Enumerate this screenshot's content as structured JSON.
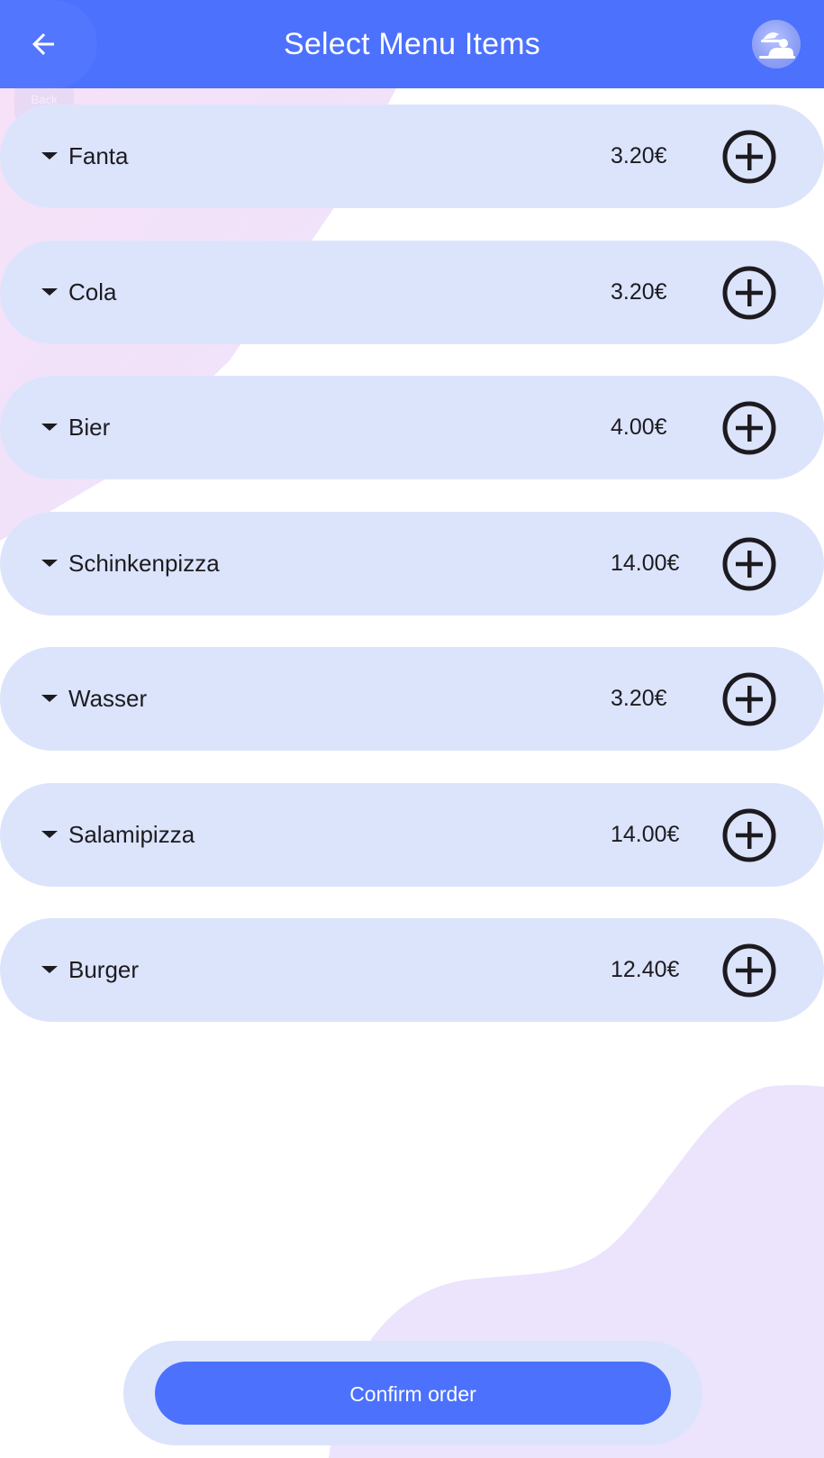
{
  "header": {
    "title": "Select Menu Items",
    "back_tooltip": "Back",
    "back_icon": "arrow-left-icon",
    "avatar_icon": "waiter-avatar-icon"
  },
  "menu": {
    "items": [
      {
        "name": "Fanta",
        "price": "3.20€"
      },
      {
        "name": "Cola",
        "price": "3.20€"
      },
      {
        "name": "Bier",
        "price": "4.00€"
      },
      {
        "name": "Schinkenpizza",
        "price": "14.00€"
      },
      {
        "name": "Wasser",
        "price": "3.20€"
      },
      {
        "name": "Salamipizza",
        "price": "14.00€"
      },
      {
        "name": "Burger",
        "price": "12.40€"
      }
    ]
  },
  "footer": {
    "confirm_label": "Confirm order"
  },
  "colors": {
    "primary": "#4b71fd",
    "item_background": "#dce4fc",
    "text": "#1d1b20",
    "background": "#ffffff"
  }
}
